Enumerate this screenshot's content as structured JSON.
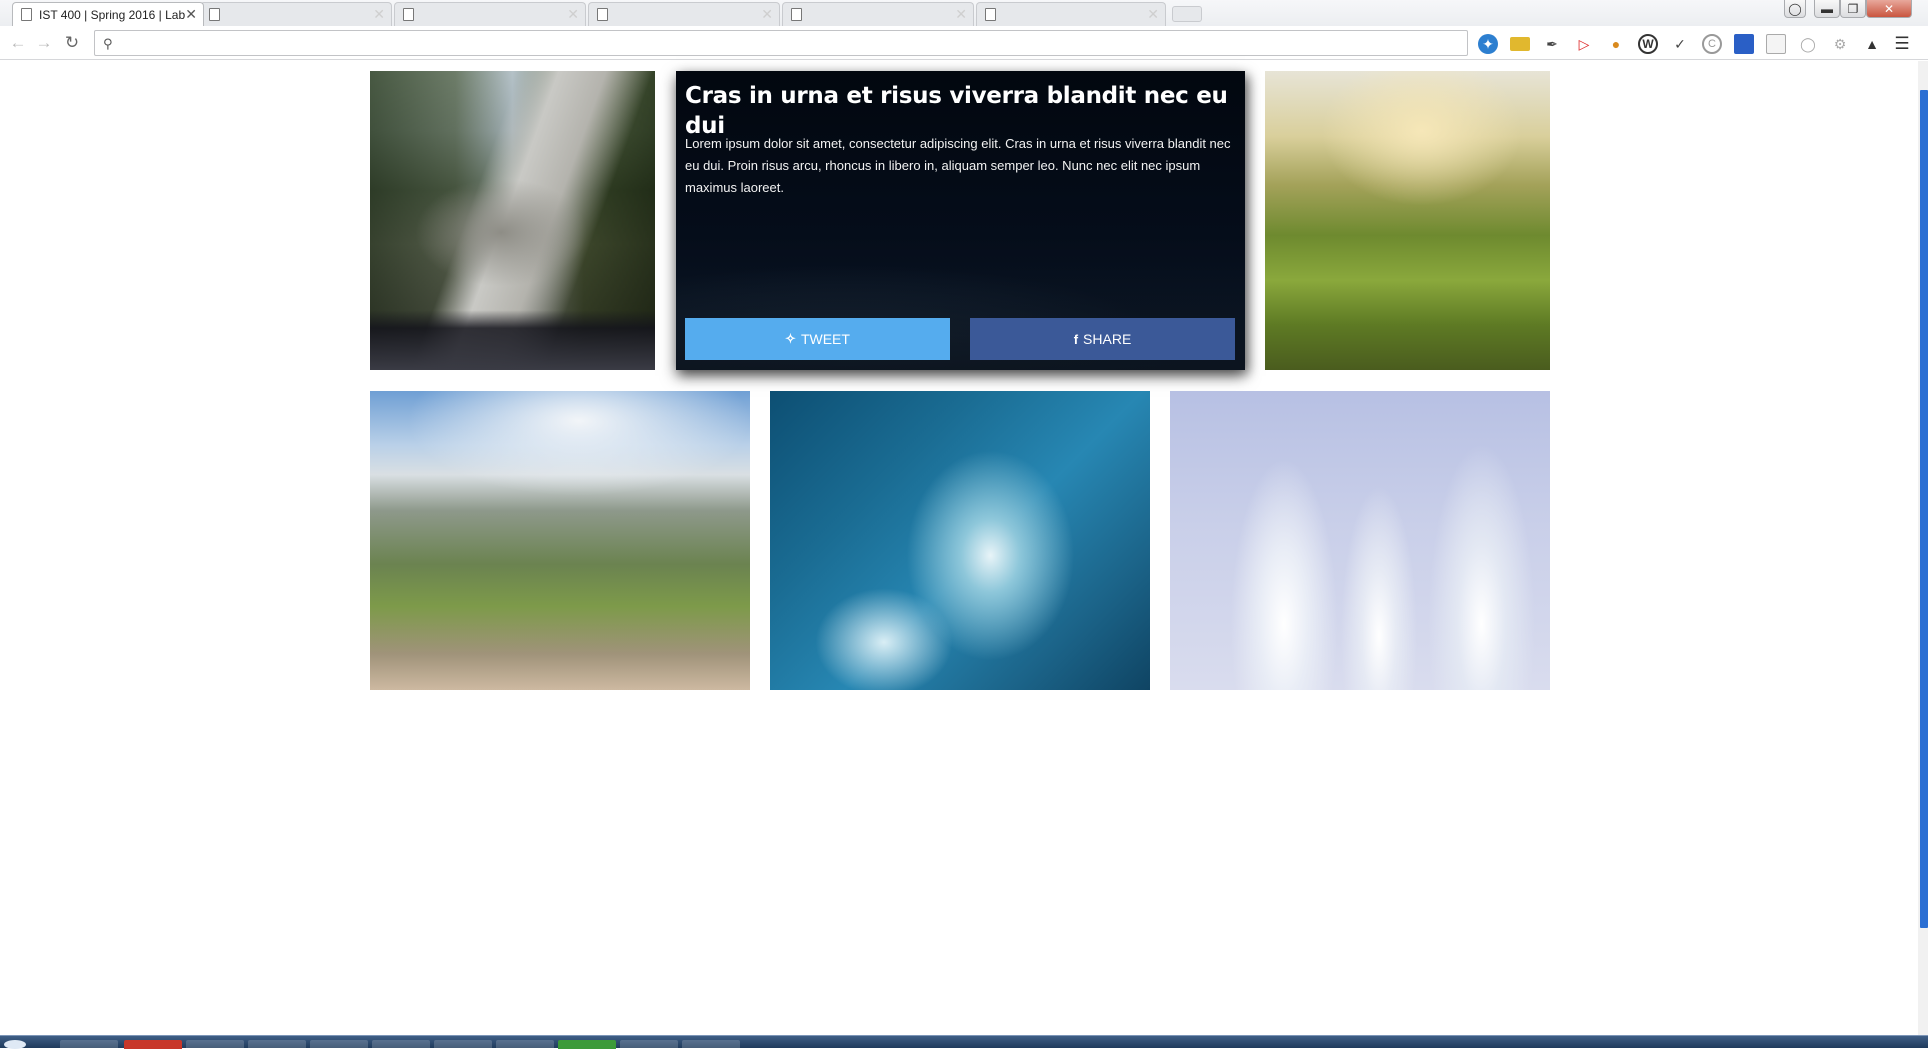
{
  "browser": {
    "tabs": [
      {
        "title": "IST 400 | Spring 2016 | Lab",
        "active": true
      },
      {
        "title": "",
        "active": false
      },
      {
        "title": "",
        "active": false
      },
      {
        "title": "",
        "active": false
      },
      {
        "title": "",
        "active": false
      },
      {
        "title": "",
        "active": false
      }
    ],
    "tab_close_glyph": "✕",
    "address_bar": {
      "value": "",
      "placeholder": ""
    },
    "icons": {
      "back": "back-arrow-icon",
      "forward": "forward-arrow-icon",
      "reload": "reload-icon",
      "search": "search-icon"
    },
    "extensions": [
      "bird-icon",
      "ruler-icon",
      "eyedropper-icon",
      "flag-icon",
      "cookie-icon",
      "wordpress-icon",
      "wappalyzer-icon",
      "c-circle-icon",
      "grid-icon",
      "page-icon",
      "sync-icon",
      "gear-icon",
      "alert-icon",
      "menu-icon"
    ]
  },
  "gallery": {
    "photos": [
      {
        "name": "road-photo",
        "alt": "road"
      },
      {
        "name": "vineyard-photo",
        "alt": "vineyard"
      },
      {
        "name": "mountain-photo",
        "alt": "mountain"
      },
      {
        "name": "water-photo",
        "alt": "water"
      },
      {
        "name": "snow-trees-photo",
        "alt": "snow trees"
      }
    ],
    "feature_card": {
      "title": "Cras in urna et risus viverra blandit nec eu dui",
      "body": "Lorem ipsum dolor sit amet, consectetur adipiscing elit. Cras in urna et risus viverra blandit nec eu dui. Proin risus arcu, rhoncus in libero in, aliquam semper leo. Nunc nec elit nec ipsum maximus laoreet.",
      "tweet_label": "TWEET",
      "share_label": "SHARE",
      "tweet_color": "#55acee",
      "share_color": "#3b5998"
    }
  },
  "colors": {
    "scrollbar_thumb": "#2b6fd3",
    "page_background": "#ffffff"
  }
}
